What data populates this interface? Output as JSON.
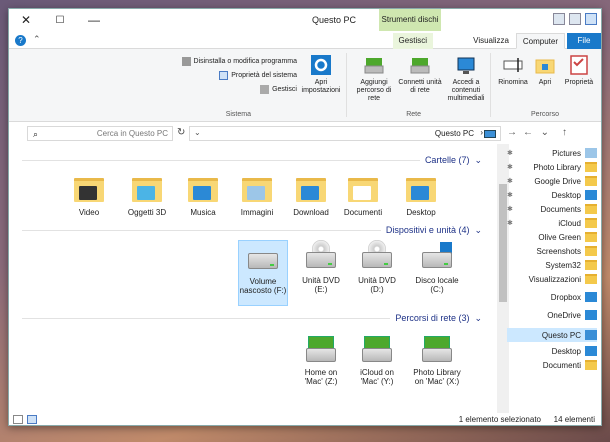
{
  "window": {
    "title": "Questo PC",
    "context_tab": "Strumenti dischi",
    "minimize": "—",
    "maximize": "☐",
    "close": "✕"
  },
  "tabs": {
    "file": "File",
    "computer": "Computer",
    "visualizza": "Visualizza",
    "gestisci": "Gestisci",
    "help": "?"
  },
  "ribbon": {
    "proprieta": "Proprietà",
    "apri": "Apri",
    "rinomina": "Rinomina",
    "accedi": "Accedi a contenuti multimediali",
    "connetti": "Connetti unità di rete",
    "aggiungi": "Aggiungi percorso di rete",
    "impostazioni": "Apri impostazioni",
    "disinstalla": "Disinstalla o modifica programma",
    "proprieta_sistema": "Proprietà del sistema",
    "gestisci": "Gestisci",
    "group_percorso": "Percorso",
    "group_rete": "Rete",
    "group_sistema": "Sistema"
  },
  "address": {
    "path": "Questo PC",
    "search_placeholder": "Cerca in Questo PC"
  },
  "sections": {
    "cartelle": "Cartelle (7)",
    "dispositivi": "Dispositivi e unità (4)",
    "percorsi": "Percorsi di rete (3)"
  },
  "folders": [
    {
      "label": "Desktop",
      "badge": "#2b89d6"
    },
    {
      "label": "Documenti",
      "badge": "#ffffff"
    },
    {
      "label": "Download",
      "badge": "#2b89d6"
    },
    {
      "label": "Immagini",
      "badge": "#9cc6e8"
    },
    {
      "label": "Musica",
      "badge": "#2b89d6"
    },
    {
      "label": "Oggetti 3D",
      "badge": "#4bb4e6"
    },
    {
      "label": "Video",
      "badge": "#333333"
    }
  ],
  "devices": [
    {
      "label": "Disco locale (C:)"
    },
    {
      "label": "Unità DVD (D:)"
    },
    {
      "label": "Unità DVD (E:)"
    },
    {
      "label": "Volume nascosto (F:)"
    }
  ],
  "network_locations": [
    {
      "label": "Photo Library on 'Mac' (X:)"
    },
    {
      "label": "iCloud on 'Mac' (Y:)"
    },
    {
      "label": "Home on 'Mac' (Z:)"
    }
  ],
  "nav": [
    {
      "label": "Pictures",
      "pinned": true
    },
    {
      "label": "Photo Library",
      "pinned": true
    },
    {
      "label": "Google Drive",
      "pinned": true
    },
    {
      "label": "Desktop",
      "pinned": true
    },
    {
      "label": "Documents",
      "pinned": true
    },
    {
      "label": "iCloud",
      "pinned": true
    },
    {
      "label": "Olive Green",
      "pinned": false
    },
    {
      "label": "Screenshots",
      "pinned": false
    },
    {
      "label": "System32",
      "pinned": false
    },
    {
      "label": "Visualizzazioni",
      "pinned": false
    },
    {
      "label": "Dropbox",
      "pinned": false
    },
    {
      "label": "OneDrive",
      "pinned": false
    },
    {
      "label": "Questo PC",
      "pinned": false
    },
    {
      "label": "Desktop",
      "pinned": false
    },
    {
      "label": "Documenti",
      "pinned": false
    }
  ],
  "status": {
    "count": "14 elementi",
    "selected": "1 elemento selezionato"
  }
}
